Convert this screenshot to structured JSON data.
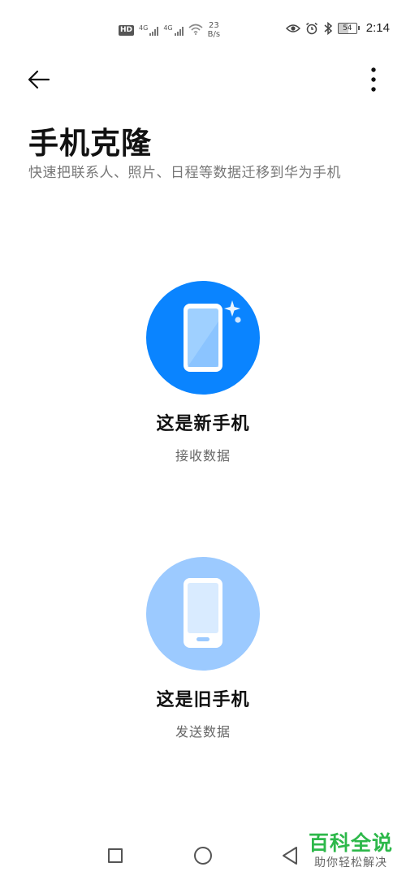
{
  "status_bar": {
    "hd_label": "HD",
    "sim1_label": "4G",
    "sim2_label": "4G",
    "net_speed_value": "23",
    "net_speed_unit": "B/s",
    "battery": "54",
    "time": "2:14",
    "icons": [
      "eye-icon",
      "alarm-icon",
      "bluetooth-icon",
      "wifi-icon",
      "battery-icon"
    ]
  },
  "header": {
    "back_icon": "arrow-left-icon",
    "more_icon": "more-vertical-icon",
    "title": "手机克隆",
    "subtitle": "快速把联系人、照片、日程等数据迁移到华为手机"
  },
  "options": [
    {
      "title": "这是新手机",
      "subtitle": "接收数据",
      "icon": "new-phone-sparkle-icon",
      "circle_color": "#0a84ff"
    },
    {
      "title": "这是旧手机",
      "subtitle": "发送数据",
      "icon": "old-phone-icon",
      "circle_color": "#9ccaff"
    }
  ],
  "nav_bar": {
    "icons": [
      "recent-apps-icon",
      "home-icon",
      "back-icon"
    ]
  },
  "watermark": {
    "main": "百科全说",
    "sub": "助你轻松解决",
    "color": "#2db84a"
  }
}
